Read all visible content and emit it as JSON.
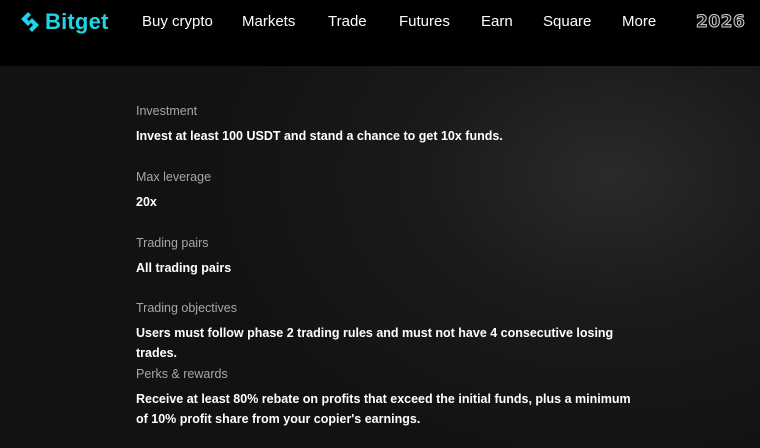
{
  "header": {
    "logo_text": "Bitget",
    "nav": [
      "Buy crypto",
      "Markets",
      "Trade",
      "Futures",
      "Earn",
      "Square",
      "More"
    ],
    "badge": "2026"
  },
  "sections": [
    {
      "label": "Investment",
      "value": "Invest at least 100 USDT and stand a chance to get 10x funds."
    },
    {
      "label": "Max leverage",
      "value": "20x"
    },
    {
      "label": "Trading pairs",
      "value": "All trading pairs"
    },
    {
      "label": "Trading objectives",
      "value": "Users must follow phase 2 trading rules and must not have 4 consecutive losing trades."
    },
    {
      "label": "Perks & rewards",
      "value": "Receive at least 80% rebate on profits that exceed the initial funds, plus a minimum of 10% profit share from your copier's earnings."
    }
  ],
  "colors": {
    "brand": "#1ed4e6",
    "background": "#000000",
    "label": "#a6a6a6"
  }
}
